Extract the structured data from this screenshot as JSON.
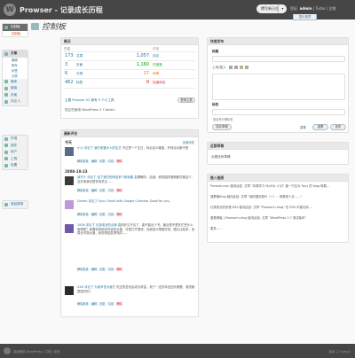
{
  "header": {
    "logo": "W",
    "site_title": "Prowser - 记录成长历程",
    "new_post": "撰写新日志",
    "howdy_prefix": "您好,",
    "howdy_user": "admin",
    "howdy_sep": " | ",
    "turbo": "Turbo",
    "logout": "注销",
    "screen_options": "显示选项"
  },
  "page": {
    "title": "控制板"
  },
  "sidebar": {
    "dashboard": "控制板",
    "dashboard_sub": [
      "控制板"
    ],
    "posts": "文章",
    "posts_sub": [
      "编辑",
      "撰写",
      "标签",
      "分类"
    ],
    "media": "媒体",
    "links": "链接",
    "pages": "页面",
    "comments": "评论",
    "comments_badge": "1",
    "appearance": "外观",
    "plugins": "插件",
    "users": "用户",
    "tools": "工具",
    "settings": "设置",
    "collapse": "收起菜单"
  },
  "right_now": {
    "title": "概况",
    "left_header": "内容",
    "right_header": "讨论",
    "rows": [
      {
        "n": "173",
        "t": "文章",
        "n2": "1,057",
        "t2": "评论",
        "c2": "green"
      },
      {
        "n": "3",
        "t": "页面",
        "n2": "1,160",
        "t2": "已批准",
        "c2": "green"
      },
      {
        "n": "6",
        "t": "分类",
        "n2": "17",
        "t2": "待审",
        "c2": "orange"
      },
      {
        "n": "462",
        "t": "标签",
        "n2": "0",
        "t2": "垃圾评论",
        "c2": "red"
      }
    ],
    "theme_line": "主题 Prowser 02 拥有 5 个小工具",
    "change_theme": "更换主题",
    "version_line": "您正在使用 WordPress 2.7-beta1."
  },
  "recent_comments": {
    "title": "最新评论",
    "view_all": "全部浏览",
    "today": "今天",
    "date2": "2008-10-23",
    "actions": [
      "解除批准",
      "编辑",
      "回复",
      "垃圾",
      "删除"
    ],
    "items": [
      {
        "head": "小小 评论了 我们老婆大人的生日",
        "text": "不过是一个生日，何必这么隆重，开啥派对都不是"
      },
      {
        "head": "读书人 评论了 给了我们的网站来个新标题",
        "text": "会理解的，加油！我的国庆假期都在做这个，这件事我也是非常关注……"
      },
      {
        "head": "Darren 评论了 Sync Gmail with Google Calendar",
        "text": "Good for you."
      },
      {
        "head": "2008 评论了 记录成长的点滴",
        "text": "真的好久不见了，能不能出个书。最近是不是在忙些什么事情呢？我看你的网页内容有点慢，可是打开很快，页面设计得挺好的。图片比较多，加载也不算太慢，我觉得还挺漂亮的……"
      },
      {
        "head": "XXX 评论了 为谁辛苦为谁忙",
        "text": "吃过的苦也会成为财富，到了一定的年纪回头看看，感觉都是挺好的！"
      }
    ]
  },
  "quickpress": {
    "title": "快速发布",
    "label_title": "标题",
    "label_upload": "上传/插入",
    "label_content": "内容",
    "label_tags": "标签",
    "tags_hint": "用逗号分隔标签",
    "save_draft": "保存草稿",
    "publish": "发布",
    "reset": "重置"
  },
  "recent_drafts": {
    "title": "近期草稿",
    "text": "近期没有草稿"
  },
  "incoming_links": {
    "title": "链入链接",
    "items": [
      "Prowser.com 链向此处: 文章 \"本周学习 MySQL 小记\" 被一只名为 Tony 的 blog 转载…",
      "菠萝格Blog 链向此处: 文章 \"我的国庆旅行（一）：带着家人去……\"",
      "记录成长的历程 RSS 链向此处: 文章 \"Prowser's blog\" 在 RSS 中被引用 ...",
      "爱看博客 | Prowser's blog 链向此处: 文章 \"WordPress 2.7 测试版本\"",
      "更多……"
    ]
  },
  "footer": {
    "left": "感谢使用 WordPress | 文档 | 反馈",
    "right": "版本 2.7-beta1"
  }
}
